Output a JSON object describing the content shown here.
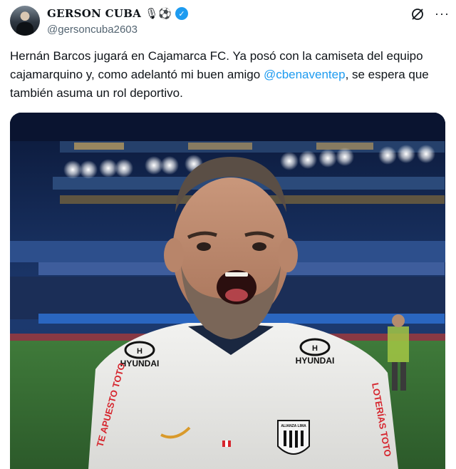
{
  "author": {
    "name": "GERSON CUBA",
    "name_emojis": "🎙⚽",
    "verified_mark": "✓",
    "handle": "@gersoncuba2603",
    "avatar_icon": "avatar-photo"
  },
  "actions": {
    "grok_icon": "grok-icon",
    "more_label": "···"
  },
  "tweet": {
    "text_before": "Hernán Barcos jugará en Cajamarca FC. Ya posó con la camiseta del equipo cajamarquino y, como adelantó mi buen amigo ",
    "mention": "@cbenaventep",
    "text_after": ", se espera que también asuma un rol deportivo."
  },
  "media": {
    "sponsor_left": "HYUNDAI",
    "sponsor_right": "HYUNDAI",
    "sleeve_left": "TE APUESTO TOTO",
    "sleeve_right": "LOTERÍAS TOTO",
    "crest_label": "ALIANZA LIMA"
  },
  "colors": {
    "accent": "#1d9bf0",
    "text": "#0f1419",
    "secondary": "#536471"
  }
}
